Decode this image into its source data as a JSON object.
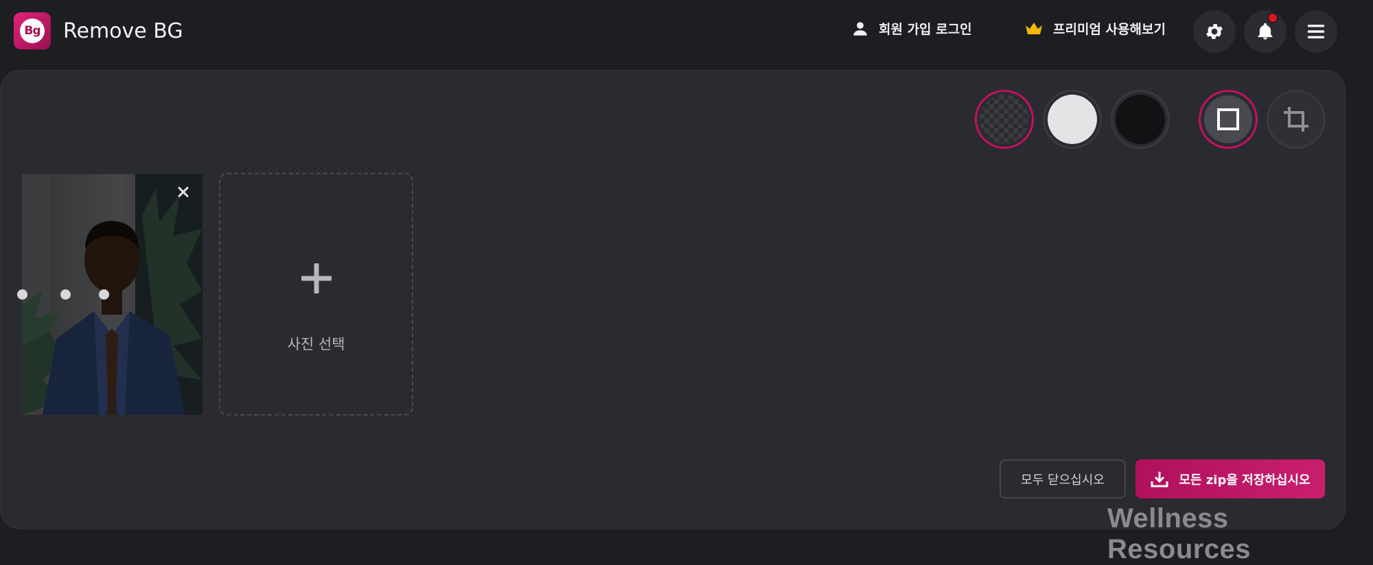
{
  "header": {
    "logo_text": "Bg",
    "app_title": "Remove BG",
    "login_label": "회원 가입 로그인",
    "premium_label": "프리미엄 사용해보기",
    "icons": {
      "login": "user-icon",
      "premium": "crown-icon",
      "settings": "gear-icon",
      "notifications": "bell-icon",
      "menu": "hamburger-menu-icon"
    },
    "has_notification": true
  },
  "toolbar": {
    "background_options": [
      "transparent",
      "white",
      "black"
    ],
    "selected_background": "transparent",
    "view_modes": [
      "full-frame",
      "crop"
    ],
    "selected_view_mode": "full-frame"
  },
  "gallery": {
    "images": [
      {
        "description_icon": "photo-thumbnail",
        "close_icon": "close-icon"
      }
    ],
    "add_card": {
      "icon": "plus-icon",
      "label": "사진 선택"
    }
  },
  "footer": {
    "close_all_label": "모두 닫으십시오",
    "save_zip_label": "모든 zip을 저장하십시오",
    "save_icon": "download-icon"
  },
  "watermark": "Wellness Resources",
  "colors": {
    "accent": "#c4105e",
    "background": "#1c1e22",
    "panel": "#292b30",
    "premium_crown": "#f5b700",
    "notification_dot": "#e0111d"
  }
}
